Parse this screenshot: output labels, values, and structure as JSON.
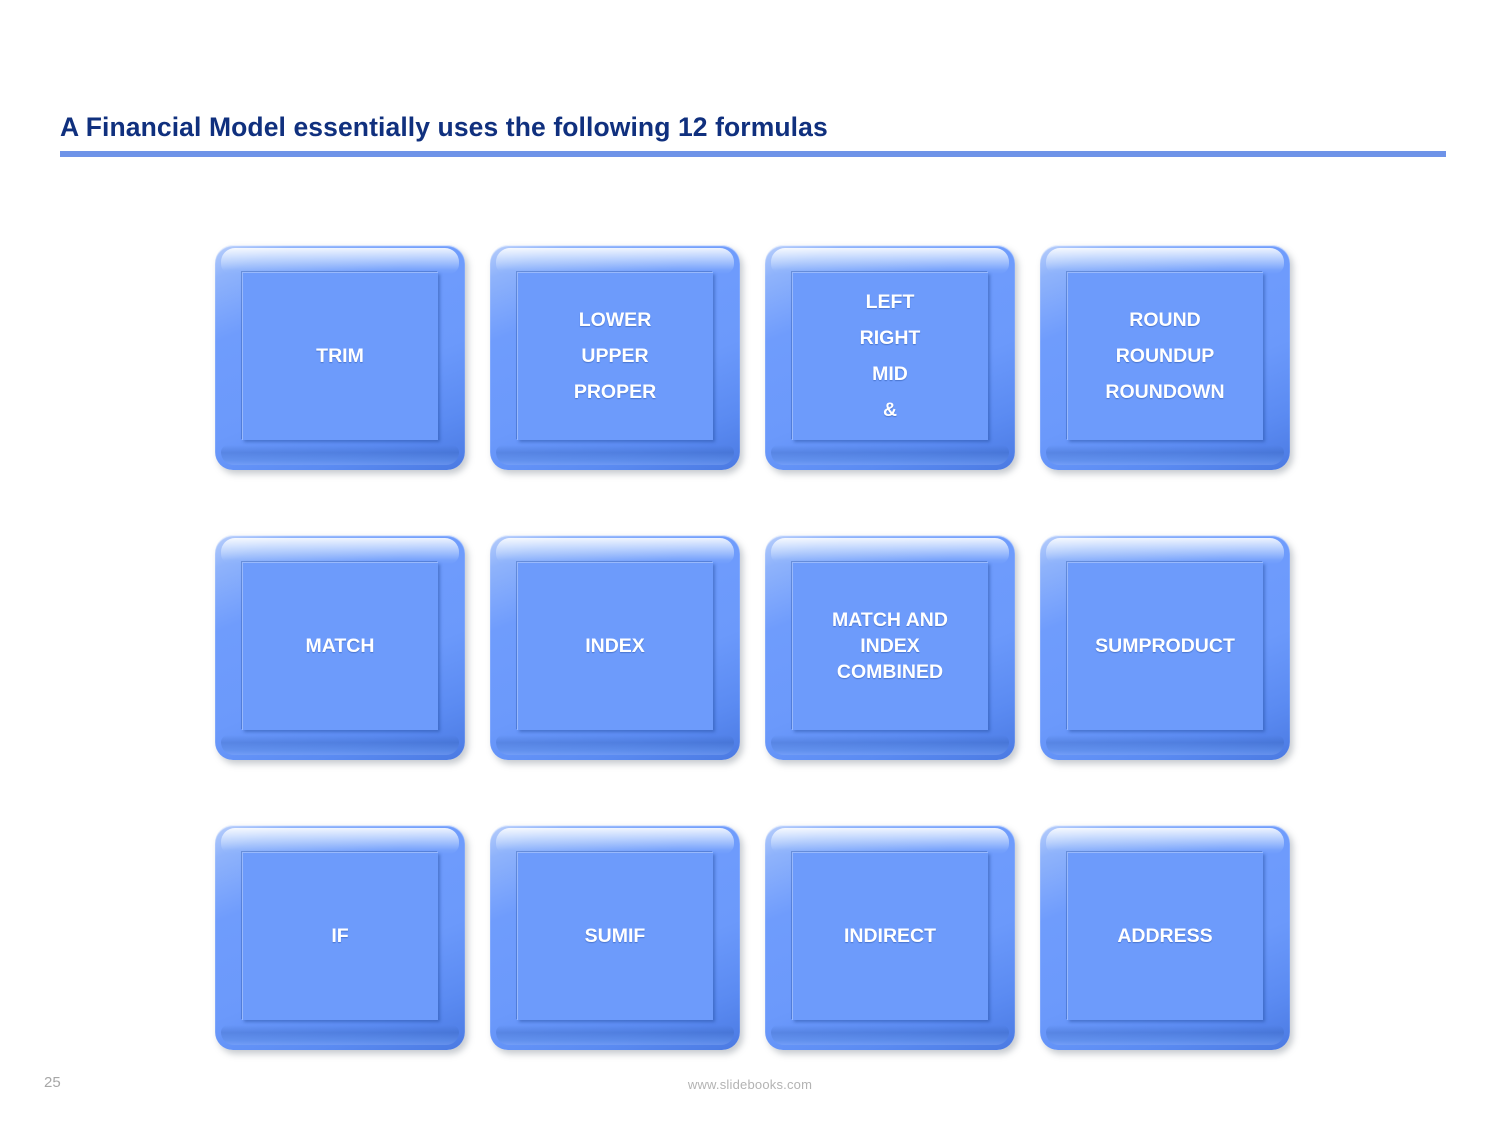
{
  "slide": {
    "title": "A Financial Model essentially uses the following 12 formulas",
    "accent_color": "#10307e",
    "rule_color": "#6e93e8",
    "box_face_color": "#6d9bfb",
    "box_label_color": "#ffffff",
    "background_color": "#ffffff"
  },
  "formulas": [
    {
      "id": "trim",
      "lines": [
        "TRIM"
      ]
    },
    {
      "id": "lower-upper-proper",
      "lines": [
        "LOWER",
        "UPPER",
        "PROPER"
      ]
    },
    {
      "id": "left-right-mid-amp",
      "lines": [
        "LEFT",
        "RIGHT",
        "MID",
        "&"
      ]
    },
    {
      "id": "round-group",
      "lines": [
        "ROUND",
        "ROUNDUP",
        "ROUNDOWN"
      ]
    },
    {
      "id": "match",
      "lines": [
        "MATCH"
      ]
    },
    {
      "id": "index",
      "lines": [
        "INDEX"
      ]
    },
    {
      "id": "match-index-combined",
      "lines": [
        "MATCH AND",
        "INDEX",
        "COMBINED"
      ]
    },
    {
      "id": "sumproduct",
      "lines": [
        "SUMPRODUCT"
      ]
    },
    {
      "id": "if",
      "lines": [
        "IF"
      ]
    },
    {
      "id": "sumif",
      "lines": [
        "SUMIF"
      ]
    },
    {
      "id": "indirect",
      "lines": [
        "INDIRECT"
      ]
    },
    {
      "id": "address",
      "lines": [
        "ADDRESS"
      ]
    }
  ],
  "footer": {
    "page_number": "25",
    "url": "www.slidebooks.com"
  }
}
